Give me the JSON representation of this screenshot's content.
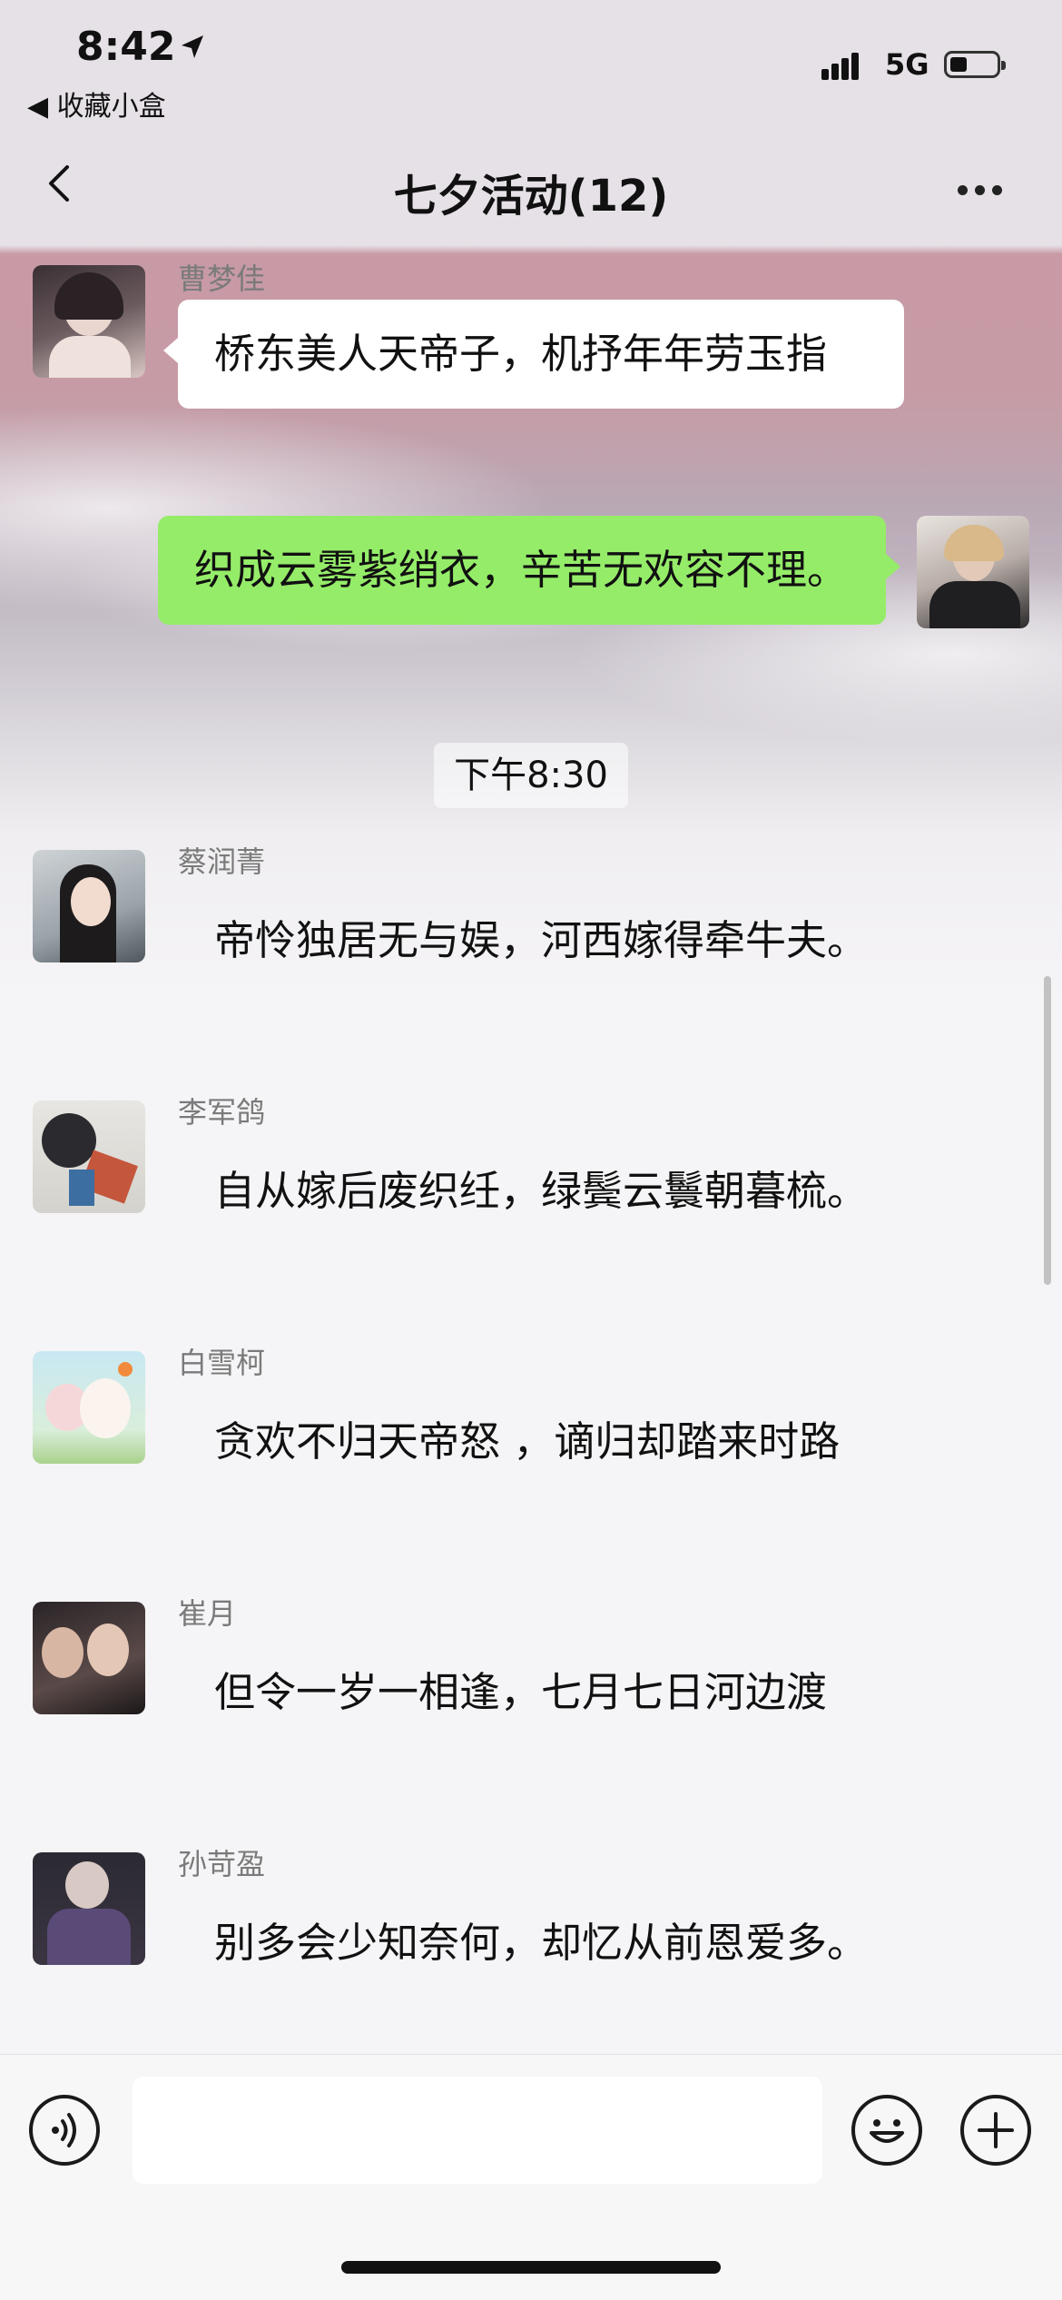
{
  "status_bar": {
    "time": "8:42",
    "back_app": "◀ 收藏小盒",
    "network": "5G"
  },
  "header": {
    "title": "七夕活动(12)"
  },
  "messages": [
    {
      "sender": "曹梦佳",
      "text": "桥东美人天帝子，机抒年年劳玉指",
      "side": "left"
    },
    {
      "sender": "",
      "text": "织成云雾紫绡衣，辛苦无欢容不理。",
      "side": "right"
    },
    {
      "sender": "蔡润菁",
      "text": "帝怜独居无与娱，河西嫁得牵牛夫。",
      "side": "left"
    },
    {
      "sender": "李军鸽",
      "text": "自从嫁后废织纴，绿鬓云鬟朝暮梳。",
      "side": "left"
    },
    {
      "sender": "白雪柯",
      "text": "贪欢不归天帝怒 ，谪归却踏来时路",
      "side": "left"
    },
    {
      "sender": "崔月",
      "text": "但令一岁一相逢，七月七日河边渡",
      "side": "left"
    },
    {
      "sender": "孙苛盈",
      "text": "别多会少知奈何，却忆从前恩爱多。",
      "side": "left"
    }
  ],
  "timestamp": "下午8:30",
  "input_bar": {
    "text_value": "",
    "voice_icon": "voice-icon",
    "emoji_icon": "emoji-icon",
    "plus_icon": "plus-icon"
  },
  "colors": {
    "bubble_self": "#95ec69",
    "bubble_other": "#ffffff"
  }
}
